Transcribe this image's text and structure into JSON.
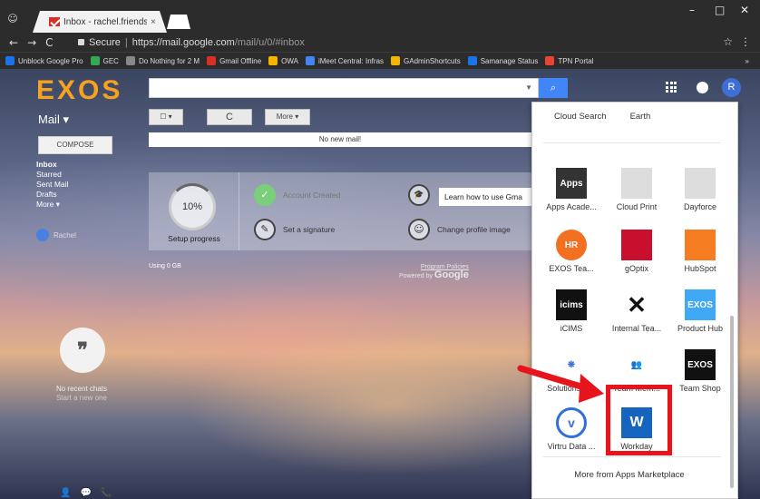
{
  "browser": {
    "tab_title": "Inbox - rachel.friends@t",
    "tab_close": "×",
    "window_controls": {
      "minimize": "–",
      "maximize": "□",
      "close": "✕"
    },
    "nav": {
      "back": "←",
      "forward": "→",
      "reload": "C"
    },
    "url": {
      "secure_label": "Secure",
      "separator": "|",
      "host": "https://mail.google.com",
      "path": "/mail/u/0/#inbox"
    },
    "star": "☆",
    "menu": "⋮",
    "bookmarks": [
      {
        "label": "Unblock Google Pro",
        "color": "#1a73e8"
      },
      {
        "label": "GEC",
        "color": "#34a853"
      },
      {
        "label": "Do Nothing for 2 M",
        "color": "#888888"
      },
      {
        "label": "Gmail Offline",
        "color": "#d93025"
      },
      {
        "label": "OWA",
        "color": "#f4b400"
      },
      {
        "label": "iMeet Central: Infras",
        "color": "#4285f4"
      },
      {
        "label": "GAdminShortcuts",
        "color": "#f4b400"
      },
      {
        "label": "Samanage Status",
        "color": "#1a73e8"
      },
      {
        "label": "TPN Portal",
        "color": "#ea4335"
      }
    ],
    "bookmarks_overflow": "»"
  },
  "gmail": {
    "logo": "EXOS",
    "search_button_icon": "search-icon",
    "avatar_letter": "R",
    "mail_menu": "Mail ▾",
    "toolbar": {
      "select": "☐ ▾",
      "refresh": "C",
      "more": "More ▾"
    },
    "compose": "COMPOSE",
    "no_mail": "No new mail!",
    "folders": [
      "Inbox",
      "Starred",
      "Sent Mail",
      "Drafts",
      "More ▾"
    ],
    "sidebar_user": "Rachel",
    "setup": {
      "progress": "10%",
      "progress_label": "Setup progress",
      "tasks": [
        {
          "label": "Account Created",
          "icon": "✓",
          "done": true
        },
        {
          "label": "Learn how to use Gma",
          "icon": "🎓",
          "done": false
        },
        {
          "label": "Set a signature",
          "icon": "✎",
          "done": false
        },
        {
          "label": "Change profile image",
          "icon": "☺",
          "done": false
        }
      ]
    },
    "usage": "Using 0 GB",
    "policies": "Program Policies",
    "powered_by": "Powered by",
    "powered_brand": "Google",
    "chat": {
      "no_recent": "No recent chats",
      "start_new": "Start a new one"
    },
    "bottom_icons": [
      "👤",
      "💬",
      "📞"
    ]
  },
  "apps_panel": {
    "top_links": [
      "Cloud Search",
      "Earth"
    ],
    "apps": [
      {
        "label": "Apps Acade...",
        "icon_text": "Apps",
        "bg": "#333333"
      },
      {
        "label": "Cloud Print",
        "icon_text": "",
        "bg": "#dddddd"
      },
      {
        "label": "Dayforce",
        "icon_text": "",
        "bg": "#dddddd"
      },
      {
        "label": "EXOS Tea...",
        "icon_text": "HR",
        "bg": "#f36f21"
      },
      {
        "label": "gOptix",
        "icon_text": "",
        "bg": "#c8102e"
      },
      {
        "label": "HubSpot",
        "icon_text": "",
        "bg": "#f57c20"
      },
      {
        "label": "iCIMS",
        "icon_text": "icims",
        "bg": "#111111"
      },
      {
        "label": "Internal Tea...",
        "icon_text": "✕",
        "bg": "#ffffff"
      },
      {
        "label": "Product Hub",
        "icon_text": "EXOS",
        "bg": "#3fa9f5"
      },
      {
        "label": "Solutions C...",
        "icon_text": "❋",
        "bg": "#ffffff"
      },
      {
        "label": "Team Mem...",
        "icon_text": "👥",
        "bg": "#ffffff"
      },
      {
        "label": "Team Shop",
        "icon_text": "EXOS",
        "bg": "#111111"
      },
      {
        "label": "Virtru Data ...",
        "icon_text": "v",
        "bg": "#ffffff"
      },
      {
        "label": "Workday",
        "icon_text": "W",
        "bg": "#1565c0"
      }
    ],
    "more": "More from Apps Marketplace"
  },
  "annotation": {
    "color": "#e8141c"
  }
}
